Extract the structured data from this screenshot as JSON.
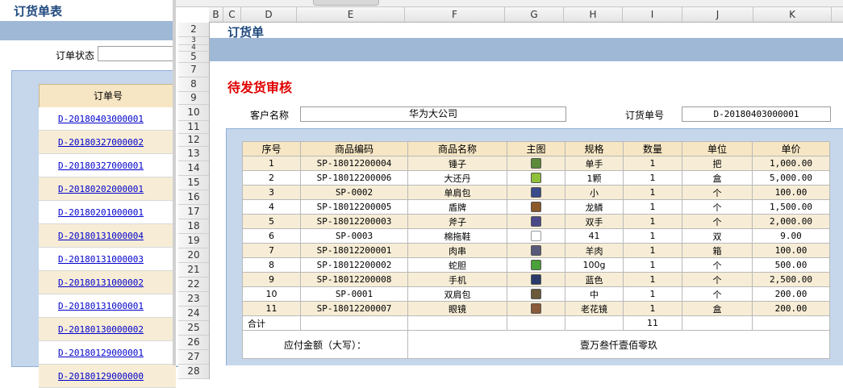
{
  "background_window": {
    "title": "订货单表",
    "status_label": "订单状态",
    "status_value": "",
    "list_header": "订单号",
    "orders": [
      "D-20180403000001",
      "D-20180327000002",
      "D-20180327000001",
      "D-20180202000001",
      "D-20180201000001",
      "D-20180131000004",
      "D-20180131000003",
      "D-20180131000002",
      "D-20180131000001",
      "D-20180130000002",
      "D-20180129000001",
      "D-20180129000000"
    ]
  },
  "spreadsheet": {
    "columns": [
      "B",
      "C",
      "D",
      "E",
      "F",
      "G",
      "H",
      "I",
      "J",
      "K"
    ],
    "rows": [
      "2",
      "3",
      "4",
      "5",
      "7",
      "8",
      "9",
      "10",
      "11",
      "12",
      "13",
      "14",
      "15",
      "16",
      "17",
      "18",
      "19",
      "20",
      "21",
      "22",
      "23",
      "24",
      "25",
      "26",
      "27",
      "28"
    ],
    "sheet_title": "订货单",
    "section_title": "待发货审核",
    "customer_label": "客户名称",
    "customer_value": "华为大公司",
    "order_no_label": "订货单号",
    "order_no_value": "D-20180403000001",
    "table": {
      "headers": [
        "序号",
        "商品编码",
        "商品名称",
        "主图",
        "规格",
        "数量",
        "单位",
        "单价"
      ],
      "rows": [
        {
          "no": "1",
          "code": "SP-18012200004",
          "name": "锤子",
          "img_color": "#5a8a3a",
          "spec": "单手",
          "qty": "1",
          "unit": "把",
          "price": "1,000.00"
        },
        {
          "no": "2",
          "code": "SP-18012200006",
          "name": "大还丹",
          "img_color": "#8fc03a",
          "spec": "1颗",
          "qty": "1",
          "unit": "盒",
          "price": "5,000.00"
        },
        {
          "no": "3",
          "code": "SP-0002",
          "name": "单肩包",
          "img_color": "#3a4a8a",
          "spec": "小",
          "qty": "1",
          "unit": "个",
          "price": "100.00"
        },
        {
          "no": "4",
          "code": "SP-18012200005",
          "name": "盾牌",
          "img_color": "#8a5a2a",
          "spec": "龙鳞",
          "qty": "1",
          "unit": "个",
          "price": "1,500.00"
        },
        {
          "no": "5",
          "code": "SP-18012200003",
          "name": "斧子",
          "img_color": "#4a4a8a",
          "spec": "双手",
          "qty": "1",
          "unit": "个",
          "price": "2,000.00"
        },
        {
          "no": "6",
          "code": "SP-0003",
          "name": "棉拖鞋",
          "img_color": "#ffffff",
          "spec": "41",
          "qty": "1",
          "unit": "双",
          "price": "9.00"
        },
        {
          "no": "7",
          "code": "SP-18012200001",
          "name": "肉串",
          "img_color": "#5a5a7a",
          "spec": "羊肉",
          "qty": "1",
          "unit": "箱",
          "price": "100.00"
        },
        {
          "no": "8",
          "code": "SP-18012200002",
          "name": "蛇胆",
          "img_color": "#4aa03a",
          "spec": "100g",
          "qty": "1",
          "unit": "个",
          "price": "500.00"
        },
        {
          "no": "9",
          "code": "SP-18012200008",
          "name": "手机",
          "img_color": "#2a3a6a",
          "spec": "蓝色",
          "qty": "1",
          "unit": "个",
          "price": "2,500.00"
        },
        {
          "no": "10",
          "code": "SP-0001",
          "name": "双肩包",
          "img_color": "#6a5a3a",
          "spec": "中",
          "qty": "1",
          "unit": "个",
          "price": "200.00"
        },
        {
          "no": "11",
          "code": "SP-18012200007",
          "name": "眼镜",
          "img_color": "#8a5a3a",
          "spec": "老花镜",
          "qty": "1",
          "unit": "盒",
          "price": "200.00"
        }
      ],
      "total_label": "合计",
      "total_qty": "11",
      "amount_label": "应付金额（大写）：",
      "amount_value": "壹万叁仟壹佰零玖"
    }
  }
}
